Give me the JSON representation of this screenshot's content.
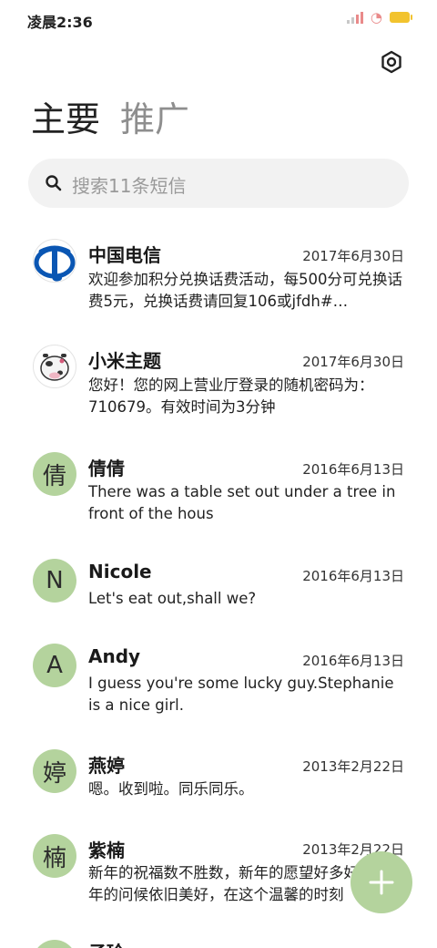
{
  "status_bar": {
    "time": "凌晨2:36"
  },
  "tabs": [
    {
      "label": "主要"
    },
    {
      "label": "推广"
    }
  ],
  "search": {
    "placeholder": "搜索11条短信"
  },
  "messages": [
    {
      "name": "中国电信",
      "date": "2017年6月30日",
      "preview": "欢迎参加积分兑换话费活动，每500分可兑换话费5元，兑换话费请回复106或jfdh#…",
      "avatar": {
        "type": "logo",
        "icon": "china-telecom-logo"
      }
    },
    {
      "name": "小米主题",
      "date": "2017年6月30日",
      "preview": "您好！您的网上营业厅登录的随机密码为：710679。有效时间为3分钟",
      "avatar": {
        "type": "logo",
        "icon": "cow-avatar"
      }
    },
    {
      "name": "倩倩",
      "date": "2016年6月13日",
      "preview": "There was a table set out under a tree in front of the hous",
      "avatar": {
        "type": "letter",
        "letter": "倩"
      }
    },
    {
      "name": "Nicole",
      "date": "2016年6月13日",
      "preview": "Let's eat out,shall we?",
      "avatar": {
        "type": "letter",
        "letter": "N"
      }
    },
    {
      "name": "Andy",
      "date": "2016年6月13日",
      "preview": "I guess you're some lucky guy.Stephanie is a nice girl.",
      "avatar": {
        "type": "letter",
        "letter": "A"
      }
    },
    {
      "name": "燕婷",
      "date": "2013年2月22日",
      "preview": "嗯。收到啦。同乐同乐。",
      "avatar": {
        "type": "letter",
        "letter": "婷"
      }
    },
    {
      "name": "紫楠",
      "date": "2013年2月22日",
      "preview": "新年的祝福数不胜数，新年的愿望好多好多，新年的问候依旧美好，在这个温馨的时刻",
      "avatar": {
        "type": "letter",
        "letter": "楠"
      }
    },
    {
      "name": "子玲",
      "date": "",
      "preview": "",
      "avatar": {
        "type": "letter",
        "letter": "玲"
      }
    }
  ],
  "colors": {
    "accent": "#b4d39d",
    "search_bg": "#f2f2f2"
  },
  "fab": {
    "icon": "plus-icon"
  }
}
